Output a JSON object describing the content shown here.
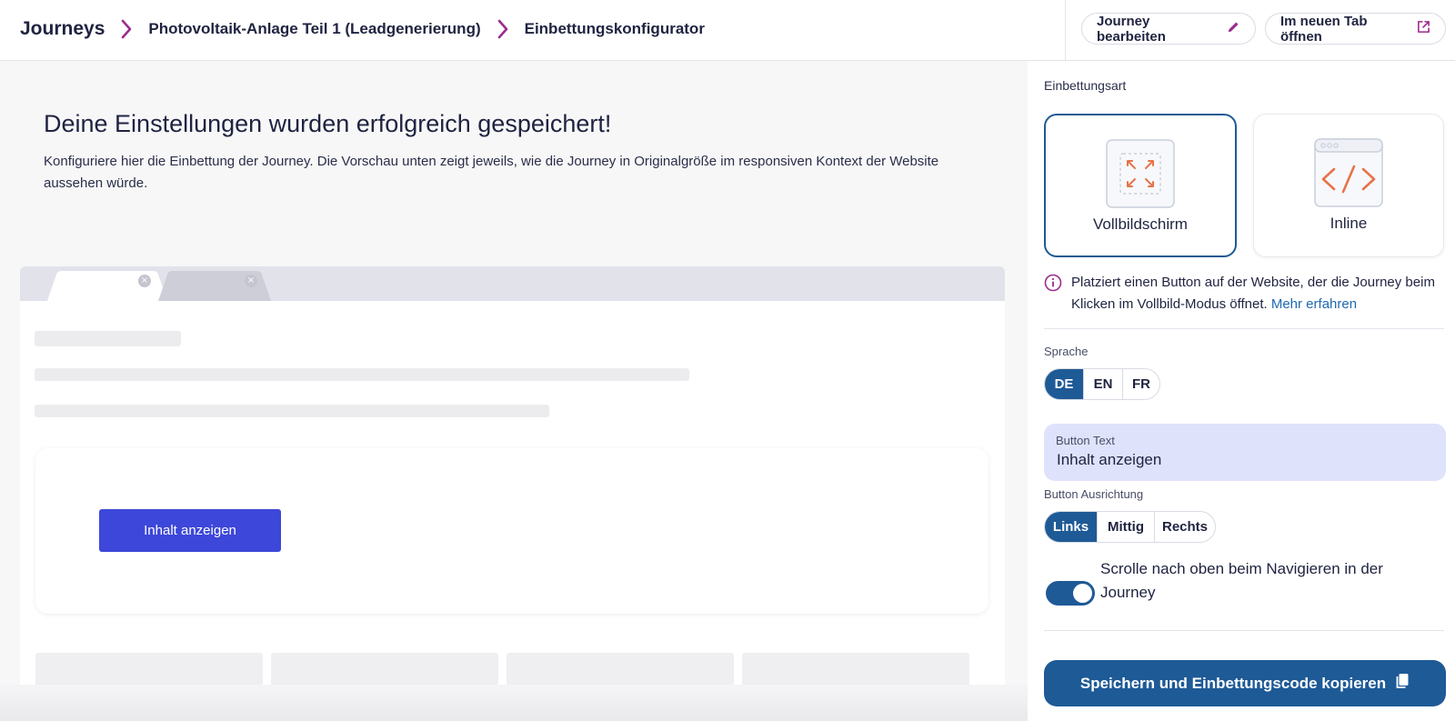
{
  "header": {
    "breadcrumb": [
      {
        "label": "Journeys"
      },
      {
        "label": "Photovoltaik-Anlage Teil 1 (Leadgenerierung)"
      },
      {
        "label": "Einbettungskonfigurator"
      }
    ],
    "edit_label": "Journey bearbeiten",
    "open_tab_label": "Im neuen Tab öffnen"
  },
  "main": {
    "success_title": "Deine Einstellungen wurden erfolgreich gespeichert!",
    "success_text": "Konfiguriere hier die Einbettung der Journey. Die Vorschau unten zeigt jeweils, wie die Journey in Originalgröße im responsiven Kontext der Website aussehen würde.",
    "preview_button": "Inhalt anzeigen"
  },
  "panel": {
    "embed_type_label": "Einbettungsart",
    "modes": [
      {
        "label": "Vollbildschirm",
        "selected": true
      },
      {
        "label": "Inline",
        "selected": false
      }
    ],
    "info_text": "Platziert einen Button auf der Website, der die Journey beim Klicken im Vollbild-Modus öffnet.",
    "info_link": "Mehr erfahren",
    "language_label": "Sprache",
    "languages": [
      "DE",
      "EN",
      "FR"
    ],
    "language_selected": "DE",
    "button_text_label": "Button Text",
    "button_text_value": "Inhalt anzeigen",
    "alignment_label": "Button Ausrichtung",
    "alignments": [
      "Links",
      "Mittig",
      "Rechts"
    ],
    "alignment_selected": "Links",
    "scroll_toggle_label": "Scrolle nach oben beim Navigieren in der Journey",
    "scroll_toggle_on": true,
    "save_label": "Speichern und Einbettungscode kopieren"
  },
  "colors": {
    "primary": "#1e5a96",
    "preview_button": "#3d47d9",
    "accent_purple": "#9b2c8e",
    "icon_orange": "#e8734a",
    "field_bg": "#dfe2fb"
  },
  "icons": [
    "chevron-right-icon",
    "pencil-icon",
    "external-link-icon",
    "fullscreen-icon",
    "code-icon",
    "info-icon",
    "copy-icon"
  ]
}
